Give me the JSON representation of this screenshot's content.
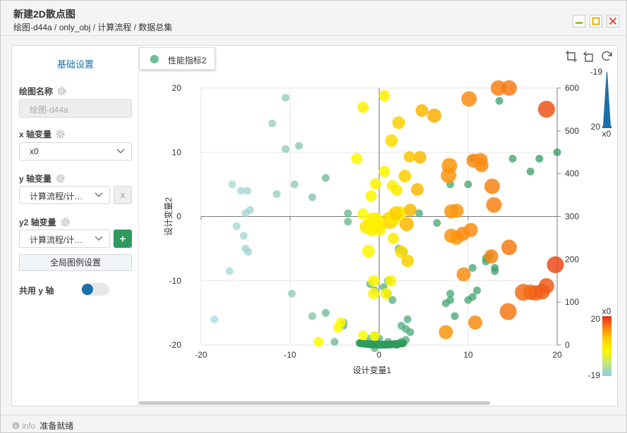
{
  "window": {
    "title": "新建2D散点图",
    "breadcrumb": "绘图-d44a / only_obj / 计算流程 / 数据总集",
    "minimize": "minimize",
    "maximize": "maximize",
    "close": "close"
  },
  "sidebar": {
    "title": "基础设置",
    "plot_name_label": "绘图名称",
    "plot_name_value": "绘图-d44a",
    "x_label": "x 轴变量",
    "x_value": "x0",
    "y_label": "y 轴变量",
    "y_value": "计算流程/计…",
    "y_clear": "x",
    "y2_label": "y2 轴变量",
    "y2_value": "计算流程/计…",
    "y2_add": "+",
    "global_legend_button": "全局图例设置",
    "shared_y_label": "共用 y 轴",
    "shared_y_on": true
  },
  "legend": {
    "label": "性能指标2",
    "color": "#6bbd92"
  },
  "toolbar": {
    "icons": [
      "crop-icon",
      "undo-icon",
      "refresh-icon"
    ]
  },
  "status": {
    "info_label": "info",
    "text": "准备就绪"
  },
  "colorbars": {
    "top": {
      "max_label": "-19",
      "min_label": "20",
      "var_label": "x0",
      "color": "#1d6fa8"
    },
    "bottom": {
      "var_label": "x0",
      "max_label": "20",
      "min_label": "-19",
      "colors": [
        "#e8341c",
        "#fb8c12",
        "#ffd400",
        "#f7f700",
        "#c8e870",
        "#8fd0d6"
      ]
    }
  },
  "chart_data": {
    "type": "scatter",
    "xlabel": "设计变量1",
    "ylabel": "设计变量2",
    "xlim": [
      -20,
      20
    ],
    "ylim": [
      -20,
      20
    ],
    "y2lim": [
      0,
      600
    ],
    "x_ticks": [
      "-20",
      "-10",
      "0",
      "10",
      "20"
    ],
    "y_ticks": [
      "-20",
      "-10",
      "0",
      "10",
      "20"
    ],
    "y2_ticks": [
      "0",
      "100",
      "200",
      "300",
      "400",
      "500",
      "600"
    ],
    "grid": true,
    "series": [
      {
        "name": "性能指标2",
        "axis": "y",
        "points": [
          [
            -10.5,
            18.5
          ],
          [
            -12,
            14.5
          ],
          [
            -10.5,
            10.5
          ],
          [
            -9,
            11
          ],
          [
            -16.5,
            5
          ],
          [
            -15.5,
            4
          ],
          [
            -14.8,
            4
          ],
          [
            -14.5,
            1
          ],
          [
            -15,
            0.5
          ],
          [
            -16,
            -1.5
          ],
          [
            -15.2,
            -3
          ],
          [
            -15,
            -5
          ],
          [
            -14.7,
            -5.5
          ],
          [
            -11.5,
            3.5
          ],
          [
            -9.5,
            5
          ],
          [
            -7.5,
            3
          ],
          [
            -6,
            6
          ],
          [
            -3.5,
            0.5
          ],
          [
            -3.5,
            -0.8
          ],
          [
            -16.8,
            -8.5
          ],
          [
            -18.5,
            -16
          ],
          [
            -9.8,
            -12
          ],
          [
            -7.5,
            -15.5
          ],
          [
            -6,
            -15
          ],
          [
            -5,
            -19.5
          ],
          [
            -4,
            -16.5
          ],
          [
            -4,
            -17
          ],
          [
            -1,
            -19
          ],
          [
            -0.5,
            -18.5
          ],
          [
            -0.5,
            -20.5
          ],
          [
            0,
            -19
          ],
          [
            1,
            -19.5
          ],
          [
            2,
            -20
          ],
          [
            2.5,
            -19.5
          ],
          [
            3,
            -19.2
          ],
          [
            3.5,
            -18
          ],
          [
            2.5,
            -17
          ],
          [
            3.2,
            -16
          ],
          [
            3,
            -17.5
          ],
          [
            2.2,
            -5
          ],
          [
            2.8,
            -5.5
          ],
          [
            -1,
            -10.5
          ],
          [
            -0.5,
            -11.5
          ],
          [
            0.5,
            -11
          ],
          [
            1,
            -12
          ],
          [
            1.5,
            -13
          ],
          [
            1,
            -10
          ],
          [
            4.5,
            0.5
          ],
          [
            6.5,
            -1
          ],
          [
            8,
            -12
          ],
          [
            8,
            -13
          ],
          [
            7.5,
            -13.5
          ],
          [
            8.5,
            -15.5
          ],
          [
            10,
            -13
          ],
          [
            10.5,
            -12.5
          ],
          [
            11,
            -11.5
          ],
          [
            12,
            -7
          ],
          [
            12.5,
            -6
          ],
          [
            13,
            -8
          ],
          [
            13,
            -8.5
          ],
          [
            12,
            -6.5
          ],
          [
            10.5,
            -8
          ],
          [
            8,
            5
          ],
          [
            10,
            5
          ],
          [
            10.5,
            9
          ],
          [
            13.5,
            18
          ],
          [
            15,
            9
          ],
          [
            17,
            7
          ],
          [
            18,
            9
          ],
          [
            20,
            10
          ]
        ],
        "arc": {
          "cx": 0.3,
          "cy": -19.7,
          "from": -2.5,
          "to": 2.5
        }
      },
      {
        "name": "",
        "axis": "y2",
        "points": [
          [
            -1.8,
            0.4,
            8,
            1.0
          ],
          [
            2.4,
            0.6,
            9,
            0.9
          ],
          [
            1.2,
            -0.6,
            12,
            0.7
          ],
          [
            -0.6,
            -0.8,
            13,
            0.9
          ],
          [
            1.6,
            -0.2,
            11,
            0.8
          ],
          [
            3.5,
            1.0,
            9,
            0.6
          ],
          [
            -1.4,
            -1.6,
            10,
            0.8
          ],
          [
            0,
            -1.9,
            10,
            0.9
          ],
          [
            -0.8,
            -2.1,
            9,
            0.9
          ],
          [
            0,
            -1.5,
            9,
            0.8
          ],
          [
            -0.4,
            -0.6,
            11,
            0.9
          ],
          [
            1.9,
            0.5,
            10,
            0.7
          ],
          [
            3.1,
            -1.2,
            10,
            0.6
          ],
          [
            0.6,
            18.8,
            8,
            0.9
          ],
          [
            -1.8,
            17,
            8,
            0.9
          ],
          [
            2.2,
            14.6,
            9,
            0.7
          ],
          [
            4.8,
            16.5,
            9,
            0.6
          ],
          [
            6.2,
            15.7,
            10,
            0.55
          ],
          [
            1.4,
            11.8,
            9,
            0.75
          ],
          [
            -2.5,
            9,
            8,
            0.95
          ],
          [
            0.6,
            7,
            8,
            0.9
          ],
          [
            -0.4,
            5.1,
            8,
            0.9
          ],
          [
            1.5,
            4.8,
            8,
            0.85
          ],
          [
            2,
            4.1,
            8,
            0.8
          ],
          [
            2.9,
            6.3,
            9,
            0.7
          ],
          [
            3.4,
            9.3,
            8,
            0.65
          ],
          [
            4.6,
            9.2,
            9,
            0.6
          ],
          [
            4.3,
            4.2,
            9,
            0.6
          ],
          [
            7.9,
            7.9,
            11,
            0.45
          ],
          [
            7.8,
            6.4,
            11,
            0.45
          ],
          [
            10.6,
            8.7,
            10,
            0.4
          ],
          [
            11.5,
            8,
            10,
            0.4
          ],
          [
            11.4,
            8.8,
            10,
            0.4
          ],
          [
            12.7,
            4.7,
            11,
            0.35
          ],
          [
            12.9,
            1.8,
            11,
            0.35
          ],
          [
            8.7,
            0.9,
            10,
            0.45
          ],
          [
            8.1,
            0.8,
            10,
            0.45
          ],
          [
            8.1,
            -3,
            10,
            0.45
          ],
          [
            8.7,
            -3.3,
            10,
            0.45
          ],
          [
            9.4,
            -2.7,
            10,
            0.4
          ],
          [
            10.3,
            -2.1,
            10,
            0.4
          ],
          [
            12.6,
            -6.2,
            10,
            0.35
          ],
          [
            14.6,
            -4.8,
            11,
            0.3
          ],
          [
            9.5,
            -9,
            10,
            0.4
          ],
          [
            10.8,
            -16.5,
            10,
            0.4
          ],
          [
            7.5,
            -18,
            10,
            0.45
          ],
          [
            14.5,
            -14.8,
            12,
            0.28
          ],
          [
            16.2,
            -11.8,
            12,
            0.22
          ],
          [
            17,
            -11.8,
            11,
            0.2
          ],
          [
            17.6,
            -11.9,
            11,
            0.18
          ],
          [
            18.3,
            -11.7,
            11,
            0.16
          ],
          [
            18.8,
            -10.8,
            11,
            0.15
          ],
          [
            19.8,
            -7.5,
            12,
            0.08
          ],
          [
            13.4,
            20,
            11,
            0.33
          ],
          [
            14.6,
            20,
            11,
            0.3
          ],
          [
            10.1,
            18.3,
            11,
            0.4
          ],
          [
            18.8,
            16.7,
            12,
            0.12
          ],
          [
            -0.9,
            3.2,
            8,
            0.95
          ],
          [
            -0.6,
            -10,
            8,
            0.95
          ],
          [
            -0.6,
            -12,
            8,
            0.95
          ],
          [
            0.8,
            -12,
            8,
            0.9
          ],
          [
            1.3,
            -10,
            8,
            0.9
          ],
          [
            -1.2,
            -5.4,
            9,
            0.95
          ],
          [
            2.5,
            -5.5,
            9,
            0.75
          ],
          [
            3.2,
            -6.9,
            9,
            0.7
          ],
          [
            1.6,
            -3.4,
            8,
            0.85
          ],
          [
            -4.3,
            -16.5,
            7,
            1.0
          ],
          [
            -4.6,
            -17.3,
            7,
            1.0
          ],
          [
            -6.8,
            -19.5,
            7,
            1.0
          ],
          [
            -1.8,
            -18.5,
            7,
            1.0
          ],
          [
            -0.5,
            -18.6,
            7,
            1.0
          ]
        ]
      }
    ]
  }
}
